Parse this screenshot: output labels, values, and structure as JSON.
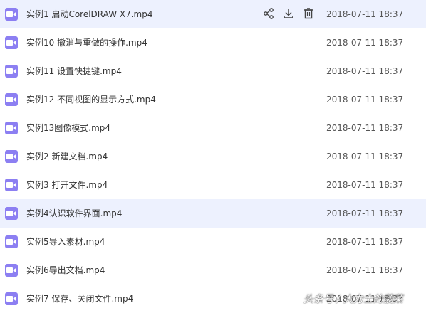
{
  "files": [
    {
      "name": "实例1 启动CorelDRAW X7.mp4",
      "date": "2018-07-11 18:37"
    },
    {
      "name": "实例10 撤消与重做的操作.mp4",
      "date": "2018-07-11 18:37"
    },
    {
      "name": "实例11 设置快捷键.mp4",
      "date": "2018-07-11 18:37"
    },
    {
      "name": "实例12 不同视图的显示方式.mp4",
      "date": "2018-07-11 18:37"
    },
    {
      "name": "实例13图像模式.mp4",
      "date": "2018-07-11 18:37"
    },
    {
      "name": "实例2 新建文档.mp4",
      "date": "2018-07-11 18:37"
    },
    {
      "name": "实例3 打开文件.mp4",
      "date": "2018-07-11 18:37"
    },
    {
      "name": "实例4认识软件界面.mp4",
      "date": "2018-07-11 18:37"
    },
    {
      "name": "实例5导入素材.mp4",
      "date": "2018-07-11 18:37"
    },
    {
      "name": "实例6导出文档.mp4",
      "date": "2018-07-11 18:37"
    },
    {
      "name": "实例7 保存、关闭文件.mp4",
      "date": "2018-07-11 18:37"
    }
  ],
  "icons": {
    "file": "video-file-icon",
    "share": "share-icon",
    "download": "download-icon",
    "delete": "trash-icon"
  },
  "colors": {
    "file_icon": "#8c7ff2",
    "row_highlight": "#edf1fe"
  },
  "watermark": "头条号 / 大力士的菠菜"
}
